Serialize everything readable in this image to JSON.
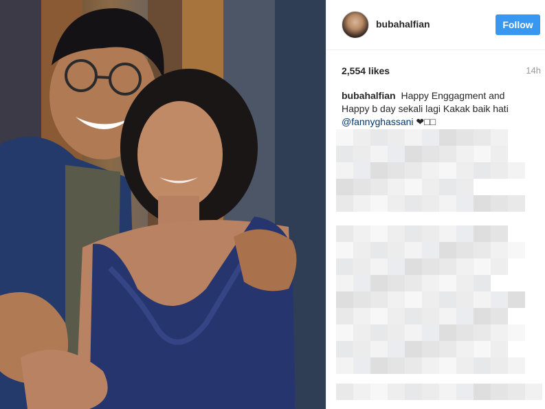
{
  "post": {
    "photo_alt": "photo",
    "username": "bubahalfian",
    "follow_label": "Follow",
    "likes": "2,554 likes",
    "time_ago": "14h",
    "caption": {
      "username": "bubahalfian",
      "text": "Happy Enggagment and Happy b day sekali lagi Kakak baik hati",
      "mention": "@fannyghassani",
      "emoji": "❤□□"
    }
  },
  "colors": {
    "follow_button": "#3897f0",
    "mention": "#003569",
    "time": "#999999",
    "divider": "#efefef"
  },
  "icons": {
    "avatar": "profile-picture"
  }
}
